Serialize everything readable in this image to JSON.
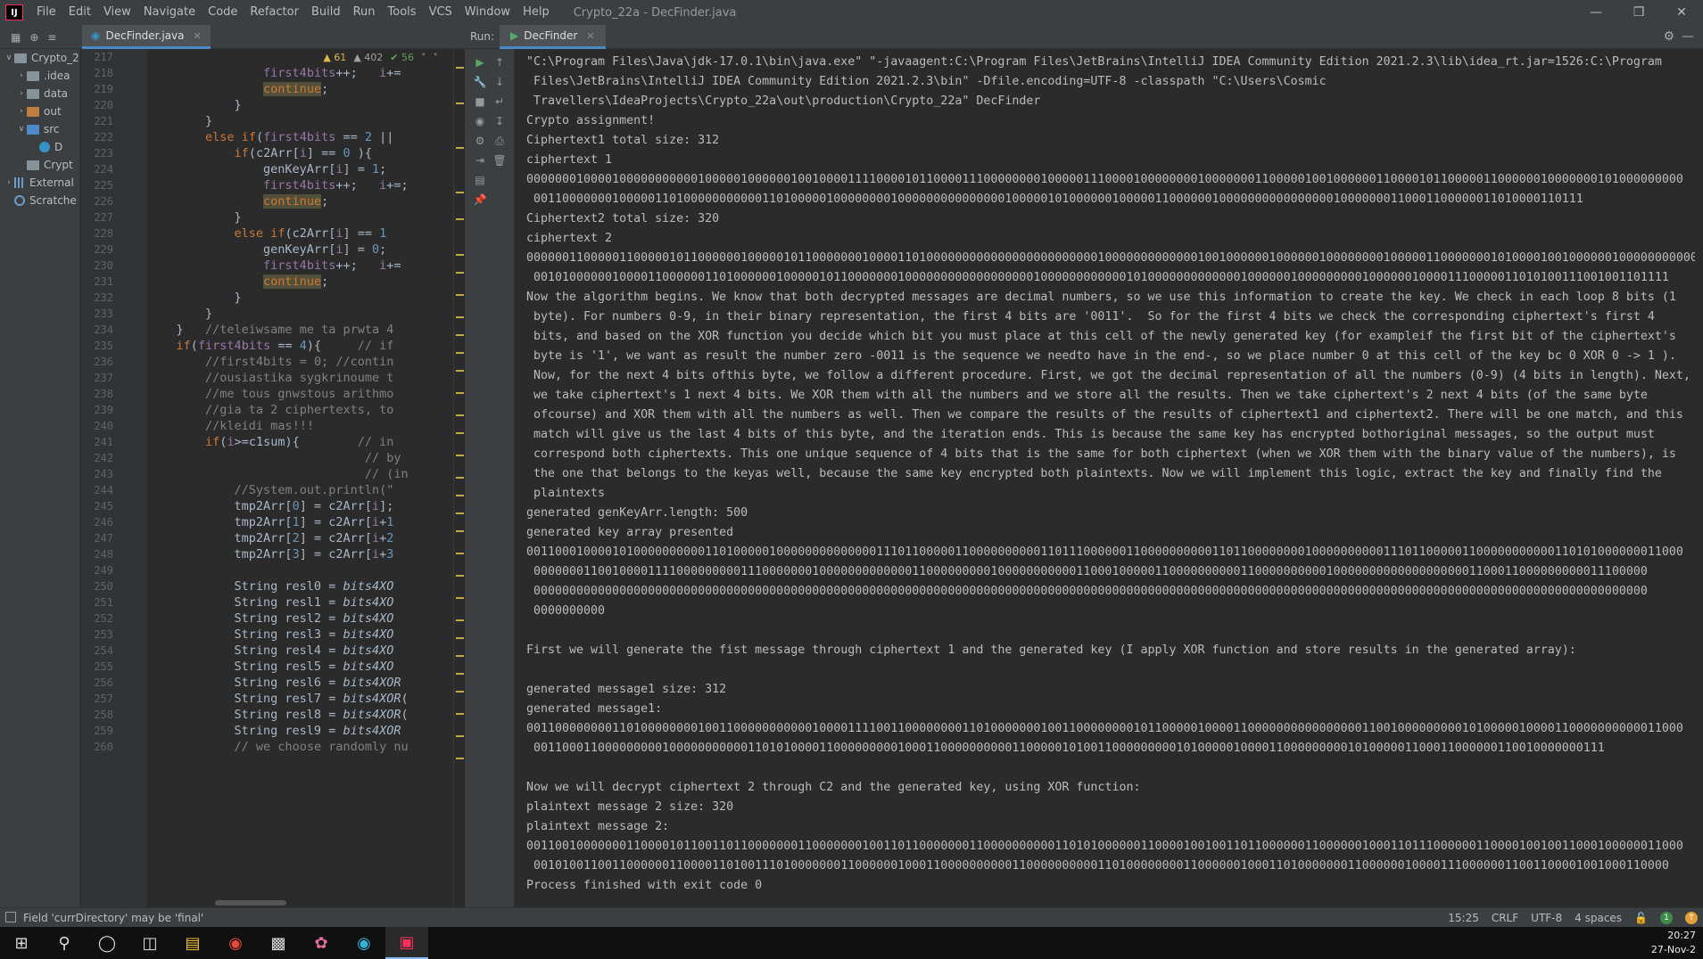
{
  "app": {
    "logo": "IJ",
    "title": "Crypto_22a - DecFinder.java",
    "menu": [
      "File",
      "Edit",
      "View",
      "Navigate",
      "Code",
      "Refactor",
      "Build",
      "Run",
      "Tools",
      "VCS",
      "Window",
      "Help"
    ]
  },
  "tabs": {
    "editor_tab": "DecFinder.java",
    "run_label": "Run:",
    "run_tab": "DecFinder"
  },
  "project_tree": [
    {
      "label": "Crypto_2",
      "indent": 0,
      "arrow": "v",
      "icon": "folder"
    },
    {
      "label": ".idea",
      "indent": 1,
      "arrow": ">",
      "icon": "folder"
    },
    {
      "label": "data",
      "indent": 1,
      "arrow": ">",
      "icon": "folder"
    },
    {
      "label": "out",
      "indent": 1,
      "arrow": ">",
      "icon": "folder-orange"
    },
    {
      "label": "src",
      "indent": 1,
      "arrow": "v",
      "icon": "folder-blue"
    },
    {
      "label": "D",
      "indent": 2,
      "arrow": "",
      "icon": "java"
    },
    {
      "label": "Crypt",
      "indent": 1,
      "arrow": "",
      "icon": "file"
    },
    {
      "label": "External",
      "indent": 0,
      "arrow": ">",
      "icon": "library"
    },
    {
      "label": "Scratche",
      "indent": 0,
      "arrow": "",
      "icon": "scratch"
    }
  ],
  "inspections": {
    "warnings": "61",
    "weak_warnings": "402",
    "ok": "56"
  },
  "code_lines": [
    {
      "n": "217",
      "html": ""
    },
    {
      "n": "218",
      "html": "                <span class='fld'>first4bits</span>++;   <span class='fld'>i</span>+="
    },
    {
      "n": "219",
      "html": "                <span class='kw hl'>continue</span>;"
    },
    {
      "n": "220",
      "html": "            }"
    },
    {
      "n": "221",
      "html": "        }"
    },
    {
      "n": "222",
      "html": "        <span class='kw'>else if</span>(<span class='fld'>first4bits</span> == <span class='num'>2</span> ||"
    },
    {
      "n": "223",
      "html": "            <span class='kw'>if</span>(c2Arr[<span class='fld'>i</span>] == <span class='num'>0</span> ){"
    },
    {
      "n": "224",
      "html": "                genKeyArr[<span class='fld'>i</span>] = <span class='num'>1</span>;"
    },
    {
      "n": "225",
      "html": "                <span class='fld'>first4bits</span>++;   <span class='fld'>i</span>+=;"
    },
    {
      "n": "226",
      "html": "                <span class='kw hl'>continue</span>;"
    },
    {
      "n": "227",
      "html": "            }"
    },
    {
      "n": "228",
      "html": "            <span class='kw'>else if</span>(c2Arr[<span class='fld'>i</span>] == <span class='num'>1</span>"
    },
    {
      "n": "229",
      "html": "                genKeyArr[<span class='fld'>i</span>] = <span class='num'>0</span>;"
    },
    {
      "n": "230",
      "html": "                <span class='fld'>first4bits</span>++;   <span class='fld'>i</span>+="
    },
    {
      "n": "231",
      "html": "                <span class='kw hl'>continue</span>;"
    },
    {
      "n": "232",
      "html": "            }"
    },
    {
      "n": "233",
      "html": "        }"
    },
    {
      "n": "234",
      "html": "    }   <span class='cm'>//teleiwsame me ta prwta 4</span>"
    },
    {
      "n": "235",
      "html": "    <span class='kw'>if</span>(<span class='fld'>first4bits</span> == <span class='num'>4</span>){     <span class='cm'>// if</span>"
    },
    {
      "n": "236",
      "html": "        <span class='cm'>//first4bits = 0; //contin</span>"
    },
    {
      "n": "237",
      "html": "        <span class='cm'>//ousiastika sygkrinoume t</span>"
    },
    {
      "n": "238",
      "html": "        <span class='cm'>//me tous gnwstous arithmo</span>"
    },
    {
      "n": "239",
      "html": "        <span class='cm'>//gia ta 2 ciphertexts, to</span>"
    },
    {
      "n": "240",
      "html": "        <span class='cm'>//kleidi mas!!!</span>"
    },
    {
      "n": "241",
      "html": "        <span class='kw'>if</span>(<span class='fld'>i</span>&gt;=c1sum){        <span class='cm'>// in</span>"
    },
    {
      "n": "242",
      "html": "                              <span class='cm'>// by</span>"
    },
    {
      "n": "243",
      "html": "                              <span class='cm'>// (in</span>"
    },
    {
      "n": "244",
      "html": "            <span class='cm'>//System.out.println(\"</span>"
    },
    {
      "n": "245",
      "html": "            tmp2Arr[<span class='num'>0</span>] = c2Arr[<span class='fld'>i</span>];"
    },
    {
      "n": "246",
      "html": "            tmp2Arr[<span class='num'>1</span>] = c2Arr[<span class='fld'>i</span>+<span class='num'>1</span>"
    },
    {
      "n": "247",
      "html": "            tmp2Arr[<span class='num'>2</span>] = c2Arr[<span class='fld'>i</span>+<span class='num'>2</span>"
    },
    {
      "n": "248",
      "html": "            tmp2Arr[<span class='num'>3</span>] = c2Arr[<span class='fld'>i</span>+<span class='num'>3</span>"
    },
    {
      "n": "249",
      "html": ""
    },
    {
      "n": "250",
      "html": "            String resl0 = <span class='it'>bits4XO</span>"
    },
    {
      "n": "251",
      "html": "            String resl1 = <span class='it'>bits4XO</span>"
    },
    {
      "n": "252",
      "html": "            String resl2 = <span class='it'>bits4XO</span>"
    },
    {
      "n": "253",
      "html": "            String resl3 = <span class='it'>bits4XO</span>"
    },
    {
      "n": "254",
      "html": "            String resl4 = <span class='it'>bits4XO</span>"
    },
    {
      "n": "255",
      "html": "            String resl5 = <span class='it'>bits4XO</span>"
    },
    {
      "n": "256",
      "html": "            String resl6 = <span class='it'>bits4XOR</span>"
    },
    {
      "n": "257",
      "html": "            String resl7 = <span class='it'>bits4XOR</span>("
    },
    {
      "n": "258",
      "html": "            String resl8 = <span class='it'>bits4XOR</span>("
    },
    {
      "n": "259",
      "html": "            String resl9 = <span class='it'>bits4XOR</span>"
    },
    {
      "n": "260",
      "html": "            <span class='cm'>// we choose randomly nu</span>"
    }
  ],
  "console_lines": [
    {
      "t": "\"C:\\Program Files\\Java\\jdk-17.0.1\\bin\\java.exe\" \"-javaagent:C:\\Program Files\\JetBrains\\IntelliJ IDEA Community Edition 2021.2.3\\lib\\idea_rt.jar=1526:C:\\Program",
      "c": false
    },
    {
      "t": "Files\\JetBrains\\IntelliJ IDEA Community Edition 2021.2.3\\bin\" -Dfile.encoding=UTF-8 -classpath \"C:\\Users\\Cosmic",
      "c": true
    },
    {
      "t": "Travellers\\IdeaProjects\\Crypto_22a\\out\\production\\Crypto_22a\" DecFinder",
      "c": true
    },
    {
      "t": "Crypto assignment!",
      "c": false
    },
    {
      "t": "Ciphertext1 total size: 312",
      "c": false
    },
    {
      "t": "ciphertext 1",
      "c": false
    },
    {
      "t": "000000010000100000000000100000100000010010000111100001011000011100000000100000111000010000000010000000110000010010000001100001011000001100000010000000101000000000",
      "c": false
    },
    {
      "t": "001100000001000001101000000000001101000001000000001000000000000000100000101000000100000110000001000000000000000010000000110001100000011010000110111",
      "c": true
    },
    {
      "t": "Ciphertext2 total size: 320",
      "c": false
    },
    {
      "t": "ciphertext 2",
      "c": false
    },
    {
      "t": "000000110000011000001011000000100000101100000001000011010000000000000000000000001000000000000010010000001000000100000000100000110000000101000010010000001000000000000",
      "c": false
    },
    {
      "t": "001010000001000011000000110100000010000010110000000100000000000000000010000000000001010000000000000100000010000000001000000100001110000011010100111001001101111",
      "c": true
    },
    {
      "t": "Now the algorithm begins. We know that both decrypted messages are decimal numbers, so we use this information to create the key. We check in each loop 8 bits (1",
      "c": false
    },
    {
      "t": "byte). For numbers 0-9, in their binary representation, the first 4 bits are '0011'.  So for the first 4 bits we check the corresponding ciphertext's first 4",
      "c": true
    },
    {
      "t": "bits, and based on the XOR function you decide which bit you must place at this cell of the newly generated key (for exampleif the first bit of the ciphertext's",
      "c": true
    },
    {
      "t": "byte is '1', we want as result the number zero -0011 is the sequence we needto have in the end-, so we place number 0 at this cell of the key bc 0 XOR 0 -> 1 ).",
      "c": true
    },
    {
      "t": "Now, for the next 4 bits ofthis byte, we follow a different procedure. First, we got the decimal representation of all the numbers (0-9) (4 bits in length). Next,",
      "c": true
    },
    {
      "t": "we take ciphertext's 1 next 4 bits. We XOR them with all the numbers and we store all the results. Then we take ciphertext's 2 next 4 bits (of the same byte",
      "c": true
    },
    {
      "t": "ofcourse) and XOR them with all the numbers as well. Then we compare the results of the results of ciphertext1 and ciphertext2. There will be one match, and this",
      "c": true
    },
    {
      "t": "match will give us the last 4 bits of this byte, and the iteration ends. This is because the same key has encrypted bothoriginal messages, so the output must",
      "c": true
    },
    {
      "t": "correspond both ciphertexts. This one unique sequence of 4 bits that is the same for both ciphertext (when we XOR them with the binary value of the numbers), is",
      "c": true
    },
    {
      "t": "the one that belongs to the keyas well, because the same key encrypted both plaintexts. Now we will implement this logic, extract the key and finally find the",
      "c": true
    },
    {
      "t": "plaintexts",
      "c": true
    },
    {
      "t": "generated genKeyArr.length: 500",
      "c": false
    },
    {
      "t": "generated key array presented",
      "c": false
    },
    {
      "t": "001100010000101000000000011010000010000000000000011101100000110000000000110111000000110000000000110110000000010000000000111011000001100000000000110101000000011000",
      "c": false
    },
    {
      "t": "000000011001000011110000000001110000000100000000000001100000000010000000000011000100000110000000000110000000000100000000000000000001100011000000000011100000",
      "c": true
    },
    {
      "t": "000000000000000000000000000000000000000000000000000000000000000000000000000000000000000000000000000000000000000000000000000000000000000000000000000000000000",
      "c": true
    },
    {
      "t": "0000000000",
      "c": true
    },
    {
      "t": "",
      "c": false
    },
    {
      "t": "First we will generate the fist message through ciphertext 1 and the generated key (I apply XOR function and store results in the generated array):",
      "c": false
    },
    {
      "t": "",
      "c": false
    },
    {
      "t": "generated message1 size: 312",
      "c": false
    },
    {
      "t": "generated message1:",
      "c": false
    },
    {
      "t": "001100000000110100000000100110000000000010000111100110000000011010000000100110000000010110000010000110000000000000000110010000000001010000010000110000000000011000",
      "c": false
    },
    {
      "t": "001100011000000000100000000000110101000011000000000100011000000000011000001010011000000000101000001000011000000000101000001100011000000110010000000111",
      "c": true
    },
    {
      "t": "",
      "c": false
    },
    {
      "t": "Now we will decrypt ciphertext 2 through C2 and the generated key, using XOR function:",
      "c": false
    },
    {
      "t": "plaintext message 2 size: 320",
      "c": false
    },
    {
      "t": "plaintext message 2:",
      "c": false
    },
    {
      "t": "001100100000001100001011001101100000001100000001001101100000001100000000001101010000001100001001001101100000011000000100011011100000011000010010011000100000011000",
      "c": false
    },
    {
      "t": "001010011001100000011000011010011101000000011000000100011000000000011000000000011010000000011000000100011010000000110000001000011100000011001100001001000110000",
      "c": true
    },
    {
      "t": "Process finished with exit code 0",
      "c": false
    }
  ],
  "status": {
    "message": "Field 'currDirectory' may be 'final'",
    "position": "15:25",
    "line_sep": "CRLF",
    "encoding": "UTF-8",
    "indent": "4 spaces",
    "badge_count": "1"
  },
  "taskbar": {
    "time": "20:27",
    "date": "27-Nov-2"
  }
}
